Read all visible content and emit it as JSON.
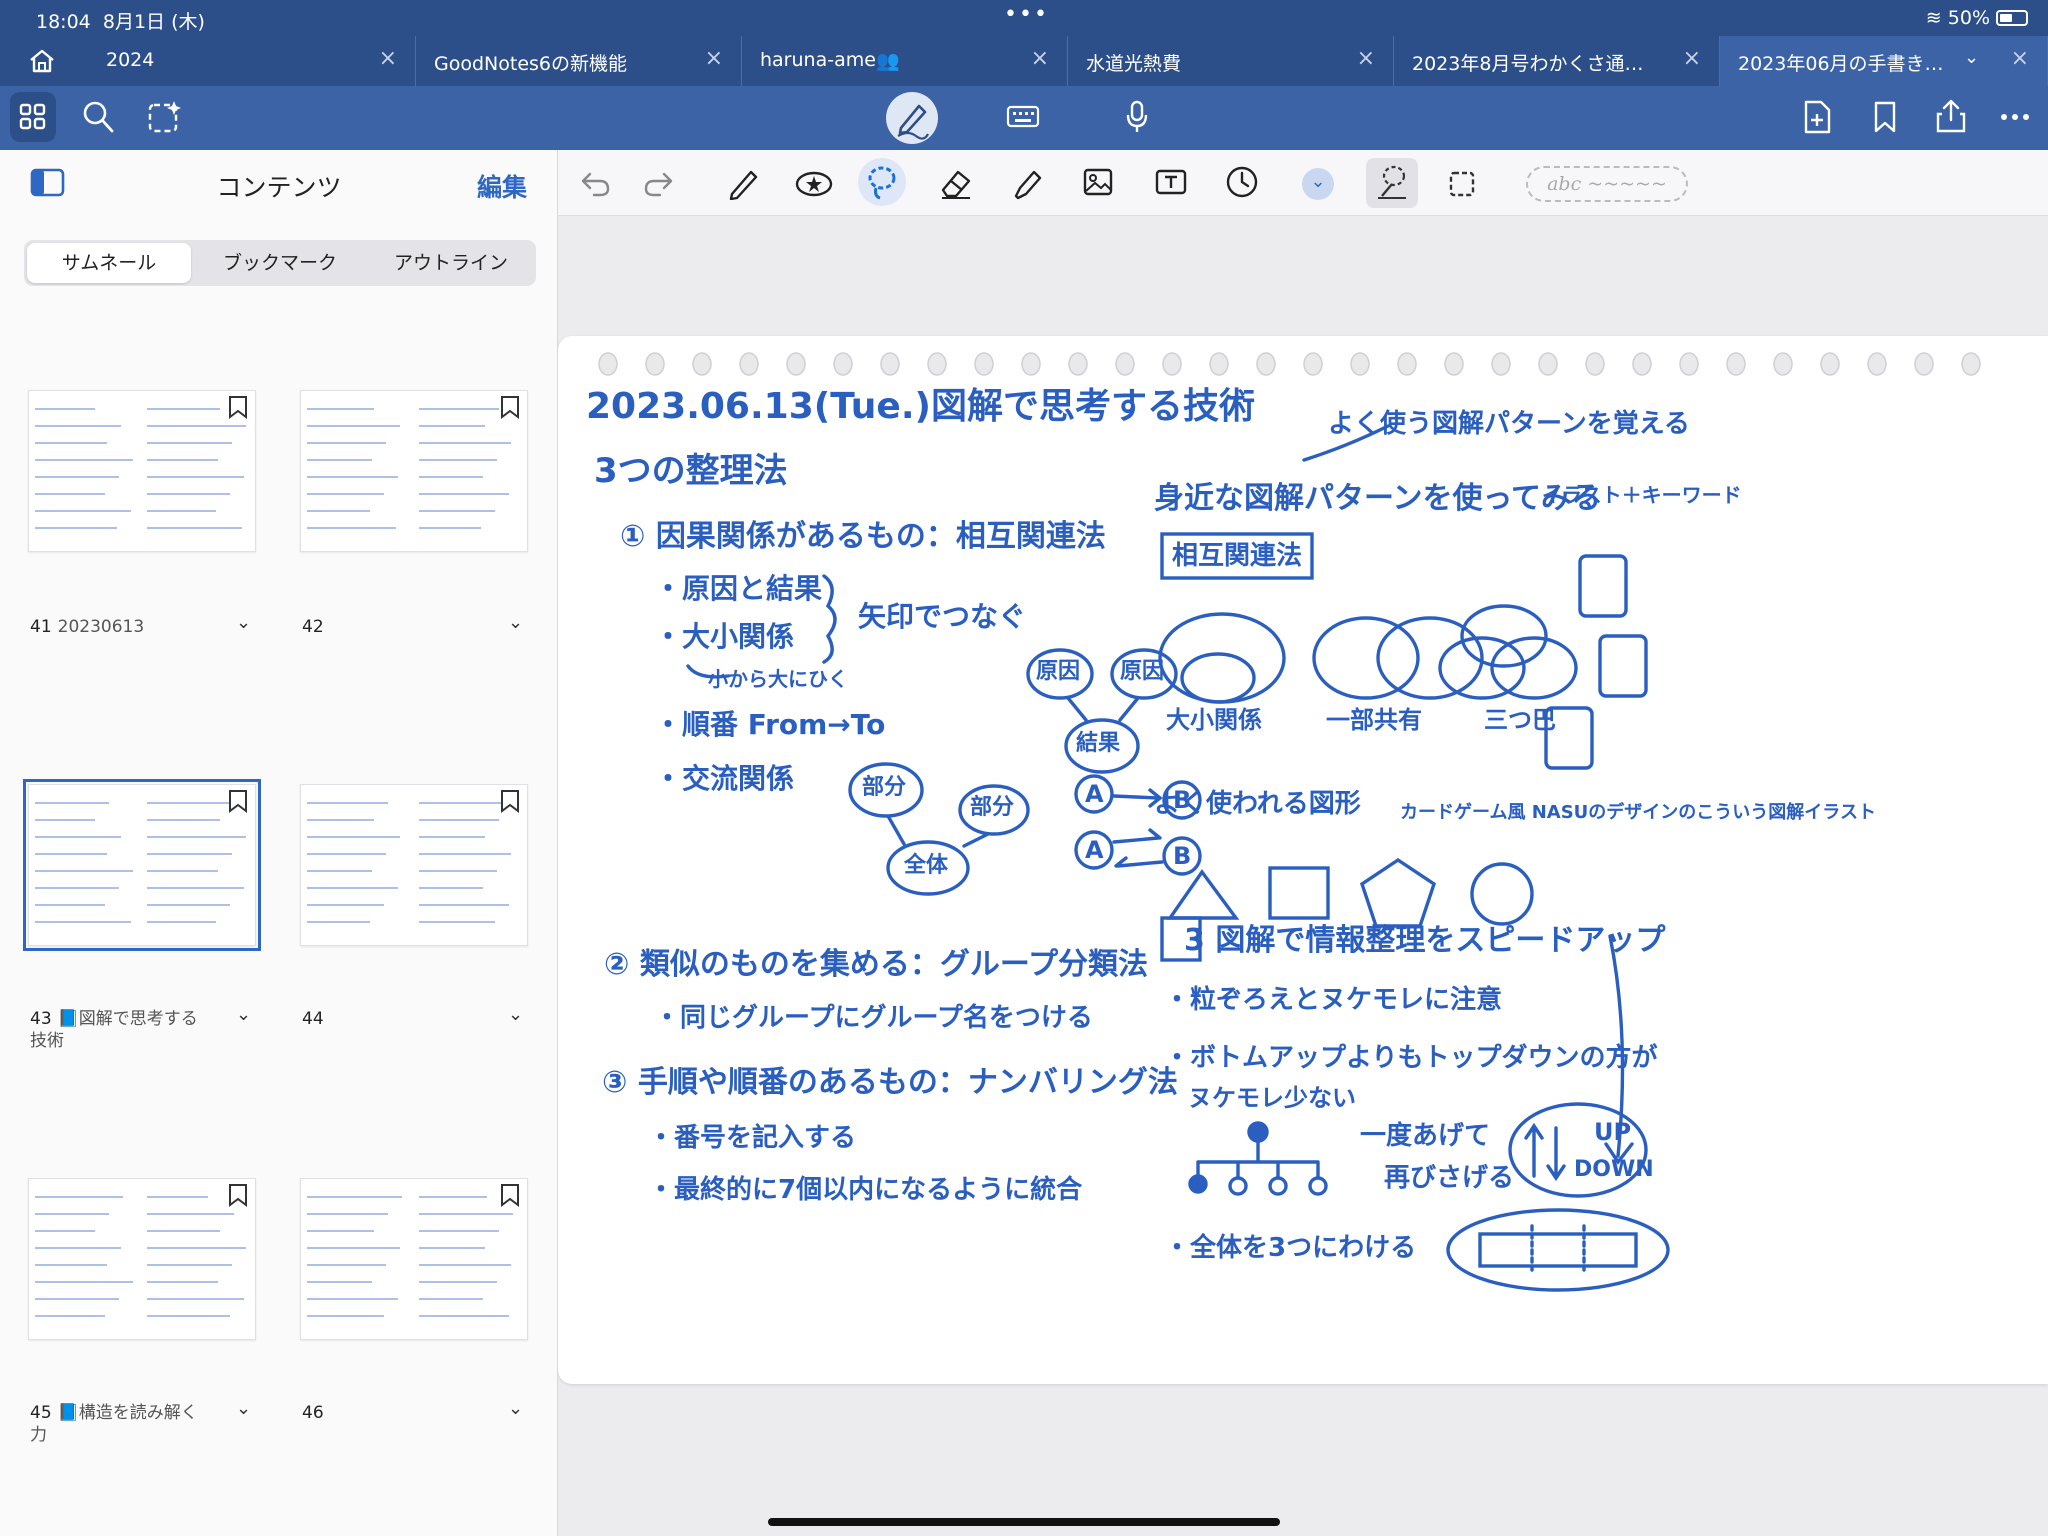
{
  "status": {
    "time": "18:04",
    "date": "8月1日 (木)",
    "battery": "50%"
  },
  "tabs": [
    {
      "label": "2024"
    },
    {
      "label": "GoodNotes6の新機能"
    },
    {
      "label": "haruna-ame"
    },
    {
      "label": "水道光熱費"
    },
    {
      "label": "2023年8月号わかくさ通…"
    },
    {
      "label": "2023年06月の手書き…"
    }
  ],
  "panel": {
    "title": "コンテンツ",
    "edit": "編集",
    "segments": [
      "サムネール",
      "ブックマーク",
      "アウトライン"
    ],
    "pages": [
      {
        "num": "41",
        "name": "20230613"
      },
      {
        "num": "42",
        "name": ""
      },
      {
        "num": "43",
        "name": "📘図解で思考する技術"
      },
      {
        "num": "44",
        "name": ""
      },
      {
        "num": "45",
        "name": "📘構造を読み解く力"
      },
      {
        "num": "46",
        "name": ""
      }
    ]
  },
  "toolbar": {
    "handwriting_placeholder": "abc ~~~~~"
  },
  "note": {
    "title": "2023.06.13(Tue.)図解で思考する技術",
    "left": {
      "h1": "3つの整理法",
      "s1": "① 因果関係があるもの：相互関連法",
      "s1a": "・原因と結果",
      "s1b": "・大小関係",
      "s1join": "矢印でつなぐ",
      "s1b_note": "小から大にひく",
      "s1c": "・順番 From→To",
      "s1d": "・交流関係",
      "bub_cause": "原因",
      "bub_result": "結果",
      "bub_part": "部分",
      "bub_whole": "全体",
      "letA": "A",
      "letB": "B",
      "s2": "② 類似のものを集める：グループ分類法",
      "s2a": "・同じグループにグループ名をつける",
      "s3": "③ 手順や順番のあるもの：ナンバリング法",
      "s3a": "・番号を記入する",
      "s3b": "・最終的に7個以内になるように統合"
    },
    "right": {
      "top": "よく使う図解パターンを覚える",
      "h": "身近な図解パターンを使ってみる",
      "box": "相互関連法",
      "illust": "イラスト＋キーワード",
      "v1": "大小関係",
      "v2": "一部共有",
      "v3": "三つ巴",
      "shapes": "よく使われる図形",
      "card": "カードゲーム風 NASUのデザインのこういう図解イラスト",
      "sec3": "3 図解で情報整理をスピードアップ",
      "p1": "・粒ぞろえとヌケモレに注意",
      "p2": "・ボトムアップよりもトップダウンの方が",
      "p2b": "ヌケモレ少ない",
      "again": "一度あげて",
      "again2": "再びさげる",
      "up": "UP",
      "down": "DOWN",
      "p3": "・全体を3つにわける"
    }
  }
}
